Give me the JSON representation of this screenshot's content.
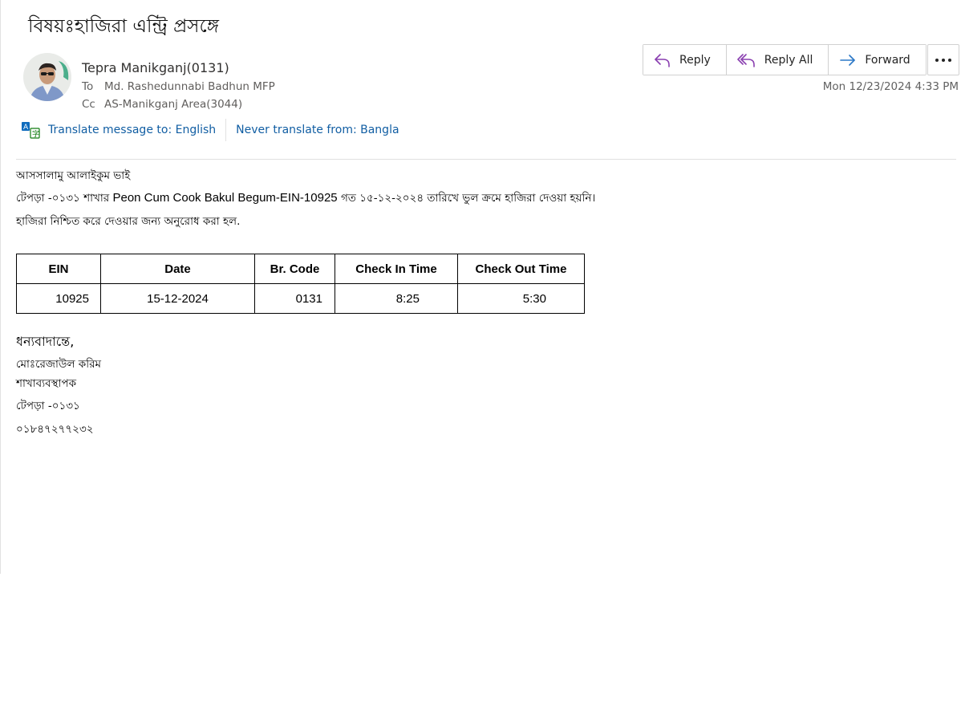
{
  "email": {
    "subject": "বিষয়ঃহাজিরা এন্ট্রি প্রসঙ্গে",
    "sender": "Tepra Manikganj(0131)",
    "to_label": "To",
    "to_value": "Md. Rashedunnabi Badhun MFP",
    "cc_label": "Cc",
    "cc_value": "AS-Manikganj Area(3044)",
    "date": "Mon 12/23/2024 4:33 PM"
  },
  "translate": {
    "translate_to": "Translate message to: English",
    "never_translate": "Never translate from: Bangla"
  },
  "actions": {
    "reply": "Reply",
    "reply_all": "Reply All",
    "forward": "Forward"
  },
  "body": {
    "greeting": "আসসালামু আলাইকুম ভাই",
    "line1_prefix": "টেপড়া -০১৩১ শাখার",
    "line1_mid": "Peon Cum Cook Bakul Begum-EIN-10925",
    "line1_suffix": "গত ১৫-১২-২০২৪ তারিখে ভুল ক্রমে হাজিরা দেওয়া হয়নি।",
    "line2": "হাজিরা নিশ্চিত করে দেওয়ার জন্য অনুরোধ করা হল.",
    "thanks": "ধন্যবাদান্তে,",
    "sig_name": "মোঃরেজাউল করিম",
    "sig_title": "শাখাব্যবস্থাপক",
    "sig_branch": "টেপড়া -০১৩১",
    "sig_phone": "০১৮৪৭২৭৭২৩২"
  },
  "table": {
    "headers": [
      "EIN",
      "Date",
      "Br. Code",
      "Check In Time",
      "Check Out Time"
    ],
    "rows": [
      [
        "10925",
        "15-12-2024",
        "0131",
        "8:25",
        "5:30"
      ]
    ]
  },
  "icons": {
    "reply": "reply-icon",
    "reply_all": "reply-all-icon",
    "forward": "forward-icon",
    "more": "more-icon",
    "translate": "translate-icon"
  },
  "colors": {
    "accent_reply": "#8a3fb0",
    "accent_forward": "#2b78c7",
    "link": "#115ea3"
  }
}
